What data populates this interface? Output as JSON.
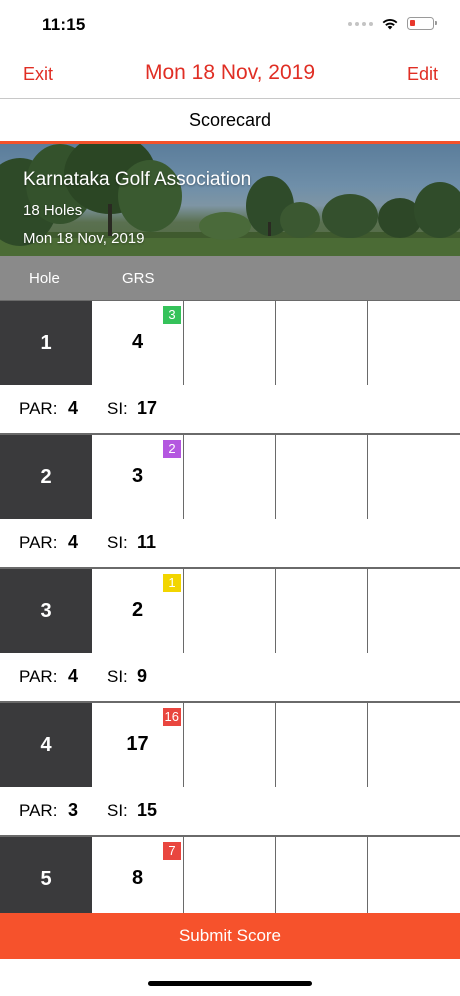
{
  "status_bar": {
    "time": "11:15",
    "battery_color": "#e8372c"
  },
  "nav": {
    "exit_label": "Exit",
    "title": "Mon 18 Nov, 2019",
    "edit_label": "Edit",
    "accent_color": "#e02e24"
  },
  "section": {
    "title": "Scorecard"
  },
  "course": {
    "name": "Karnataka Golf Association",
    "holes": "18 Holes",
    "date": "Mon 18 Nov, 2019"
  },
  "table_header": {
    "hole": "Hole",
    "grs": "GRS"
  },
  "holes": [
    {
      "hole": "1",
      "score": "4",
      "badge": "3",
      "badge_color": "#35c25a",
      "par_label": "PAR:",
      "par": "4",
      "si_label": "SI:",
      "si": "17"
    },
    {
      "hole": "2",
      "score": "3",
      "badge": "2",
      "badge_color": "#b457e0",
      "par_label": "PAR:",
      "par": "4",
      "si_label": "SI:",
      "si": "11"
    },
    {
      "hole": "3",
      "score": "2",
      "badge": "1",
      "badge_color": "#f2d500",
      "par_label": "PAR:",
      "par": "4",
      "si_label": "SI:",
      "si": "9"
    },
    {
      "hole": "4",
      "score": "17",
      "badge": "16",
      "badge_color": "#e9463f",
      "par_label": "PAR:",
      "par": "3",
      "si_label": "SI:",
      "si": "15"
    },
    {
      "hole": "5",
      "score": "8",
      "badge": "7",
      "badge_color": "#e9463f"
    }
  ],
  "footer": {
    "submit_label": "Submit Score",
    "submit_color": "#f6522c"
  }
}
